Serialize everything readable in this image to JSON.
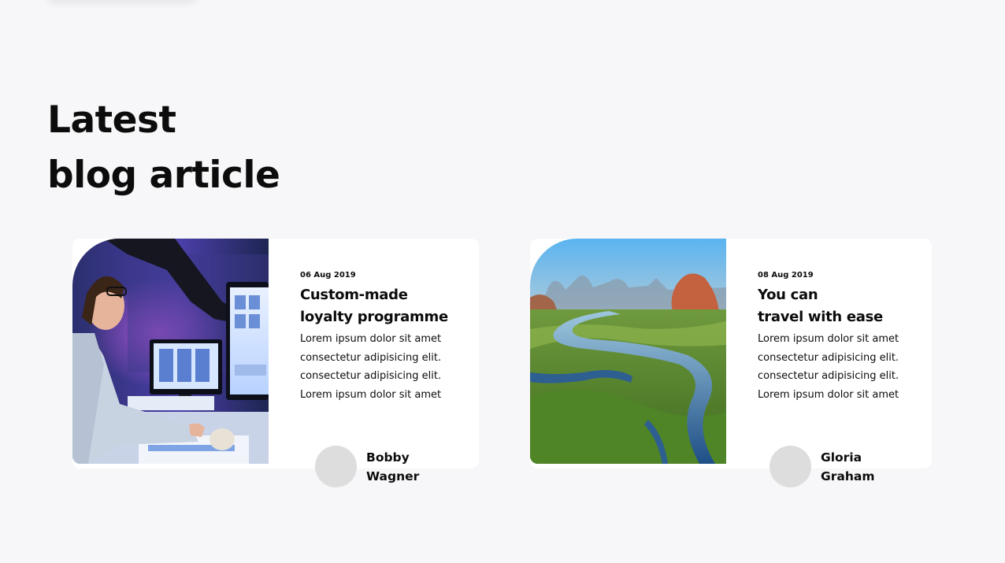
{
  "section": {
    "title_line1": "Latest",
    "title_line2": "blog article"
  },
  "articles": [
    {
      "date": "06 Aug 2019",
      "title_line1": "Custom-made",
      "title_line2": "loyalty programme",
      "text_lines": [
        "Lorem ipsum dolor sit amet",
        "consectetur adipisicing elit.",
        "consectetur adipisicing elit.",
        "Lorem ipsum dolor sit amet"
      ],
      "author_first": "Bobby",
      "author_last": "Wagner",
      "image": "designer-at-computer-photo"
    },
    {
      "date": "08 Aug 2019",
      "title_line1": "You can",
      "title_line2": "travel with ease",
      "text_lines": [
        "Lorem ipsum dolor sit amet",
        "consectetur adipisicing elit.",
        "consectetur adipisicing elit.",
        "Lorem ipsum dolor sit amet"
      ],
      "author_first": "Gloria",
      "author_last": "Graham",
      "image": "river-landscape-photo"
    }
  ]
}
